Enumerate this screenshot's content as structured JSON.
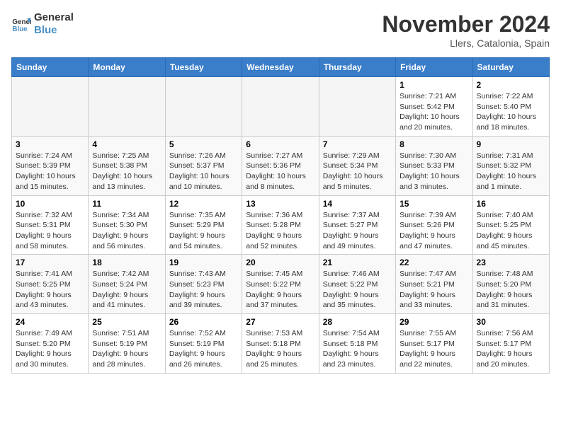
{
  "header": {
    "logo_line1": "General",
    "logo_line2": "Blue",
    "month_title": "November 2024",
    "location": "Llers, Catalonia, Spain"
  },
  "weekdays": [
    "Sunday",
    "Monday",
    "Tuesday",
    "Wednesday",
    "Thursday",
    "Friday",
    "Saturday"
  ],
  "weeks": [
    [
      {
        "day": "",
        "info": ""
      },
      {
        "day": "",
        "info": ""
      },
      {
        "day": "",
        "info": ""
      },
      {
        "day": "",
        "info": ""
      },
      {
        "day": "",
        "info": ""
      },
      {
        "day": "1",
        "info": "Sunrise: 7:21 AM\nSunset: 5:42 PM\nDaylight: 10 hours\nand 20 minutes."
      },
      {
        "day": "2",
        "info": "Sunrise: 7:22 AM\nSunset: 5:40 PM\nDaylight: 10 hours\nand 18 minutes."
      }
    ],
    [
      {
        "day": "3",
        "info": "Sunrise: 7:24 AM\nSunset: 5:39 PM\nDaylight: 10 hours\nand 15 minutes."
      },
      {
        "day": "4",
        "info": "Sunrise: 7:25 AM\nSunset: 5:38 PM\nDaylight: 10 hours\nand 13 minutes."
      },
      {
        "day": "5",
        "info": "Sunrise: 7:26 AM\nSunset: 5:37 PM\nDaylight: 10 hours\nand 10 minutes."
      },
      {
        "day": "6",
        "info": "Sunrise: 7:27 AM\nSunset: 5:36 PM\nDaylight: 10 hours\nand 8 minutes."
      },
      {
        "day": "7",
        "info": "Sunrise: 7:29 AM\nSunset: 5:34 PM\nDaylight: 10 hours\nand 5 minutes."
      },
      {
        "day": "8",
        "info": "Sunrise: 7:30 AM\nSunset: 5:33 PM\nDaylight: 10 hours\nand 3 minutes."
      },
      {
        "day": "9",
        "info": "Sunrise: 7:31 AM\nSunset: 5:32 PM\nDaylight: 10 hours\nand 1 minute."
      }
    ],
    [
      {
        "day": "10",
        "info": "Sunrise: 7:32 AM\nSunset: 5:31 PM\nDaylight: 9 hours\nand 58 minutes."
      },
      {
        "day": "11",
        "info": "Sunrise: 7:34 AM\nSunset: 5:30 PM\nDaylight: 9 hours\nand 56 minutes."
      },
      {
        "day": "12",
        "info": "Sunrise: 7:35 AM\nSunset: 5:29 PM\nDaylight: 9 hours\nand 54 minutes."
      },
      {
        "day": "13",
        "info": "Sunrise: 7:36 AM\nSunset: 5:28 PM\nDaylight: 9 hours\nand 52 minutes."
      },
      {
        "day": "14",
        "info": "Sunrise: 7:37 AM\nSunset: 5:27 PM\nDaylight: 9 hours\nand 49 minutes."
      },
      {
        "day": "15",
        "info": "Sunrise: 7:39 AM\nSunset: 5:26 PM\nDaylight: 9 hours\nand 47 minutes."
      },
      {
        "day": "16",
        "info": "Sunrise: 7:40 AM\nSunset: 5:25 PM\nDaylight: 9 hours\nand 45 minutes."
      }
    ],
    [
      {
        "day": "17",
        "info": "Sunrise: 7:41 AM\nSunset: 5:25 PM\nDaylight: 9 hours\nand 43 minutes."
      },
      {
        "day": "18",
        "info": "Sunrise: 7:42 AM\nSunset: 5:24 PM\nDaylight: 9 hours\nand 41 minutes."
      },
      {
        "day": "19",
        "info": "Sunrise: 7:43 AM\nSunset: 5:23 PM\nDaylight: 9 hours\nand 39 minutes."
      },
      {
        "day": "20",
        "info": "Sunrise: 7:45 AM\nSunset: 5:22 PM\nDaylight: 9 hours\nand 37 minutes."
      },
      {
        "day": "21",
        "info": "Sunrise: 7:46 AM\nSunset: 5:22 PM\nDaylight: 9 hours\nand 35 minutes."
      },
      {
        "day": "22",
        "info": "Sunrise: 7:47 AM\nSunset: 5:21 PM\nDaylight: 9 hours\nand 33 minutes."
      },
      {
        "day": "23",
        "info": "Sunrise: 7:48 AM\nSunset: 5:20 PM\nDaylight: 9 hours\nand 31 minutes."
      }
    ],
    [
      {
        "day": "24",
        "info": "Sunrise: 7:49 AM\nSunset: 5:20 PM\nDaylight: 9 hours\nand 30 minutes."
      },
      {
        "day": "25",
        "info": "Sunrise: 7:51 AM\nSunset: 5:19 PM\nDaylight: 9 hours\nand 28 minutes."
      },
      {
        "day": "26",
        "info": "Sunrise: 7:52 AM\nSunset: 5:19 PM\nDaylight: 9 hours\nand 26 minutes."
      },
      {
        "day": "27",
        "info": "Sunrise: 7:53 AM\nSunset: 5:18 PM\nDaylight: 9 hours\nand 25 minutes."
      },
      {
        "day": "28",
        "info": "Sunrise: 7:54 AM\nSunset: 5:18 PM\nDaylight: 9 hours\nand 23 minutes."
      },
      {
        "day": "29",
        "info": "Sunrise: 7:55 AM\nSunset: 5:17 PM\nDaylight: 9 hours\nand 22 minutes."
      },
      {
        "day": "30",
        "info": "Sunrise: 7:56 AM\nSunset: 5:17 PM\nDaylight: 9 hours\nand 20 minutes."
      }
    ]
  ]
}
